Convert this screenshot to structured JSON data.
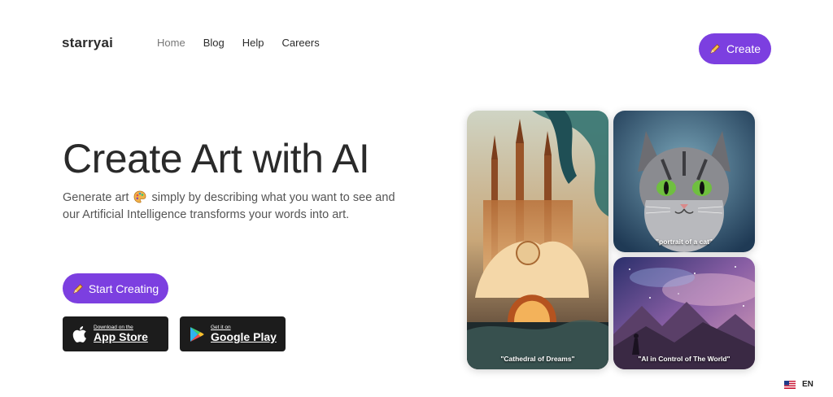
{
  "brand": {
    "logo": "starryai",
    "accent": "#7c3fe0"
  },
  "nav": {
    "items": [
      {
        "label": "Home",
        "active": true
      },
      {
        "label": "Blog"
      },
      {
        "label": "Help"
      },
      {
        "label": "Careers"
      }
    ],
    "create_label": "Create"
  },
  "hero": {
    "title": "Create Art with AI",
    "sub_before": "Generate art",
    "sub_after": "simply by describing what you want to see and our Artificial Intelligence transforms your words into art.",
    "start_label": "Start Creating"
  },
  "stores": {
    "app": {
      "small": "Download on the",
      "big": "App Store"
    },
    "play": {
      "small": "Get it on",
      "big": "Google Play"
    }
  },
  "gallery": {
    "captions": [
      "\"Cathedral of Dreams\"",
      "\"portrait of a cat\"",
      "\"AI in Control of The World\""
    ]
  },
  "language": {
    "code": "EN"
  }
}
